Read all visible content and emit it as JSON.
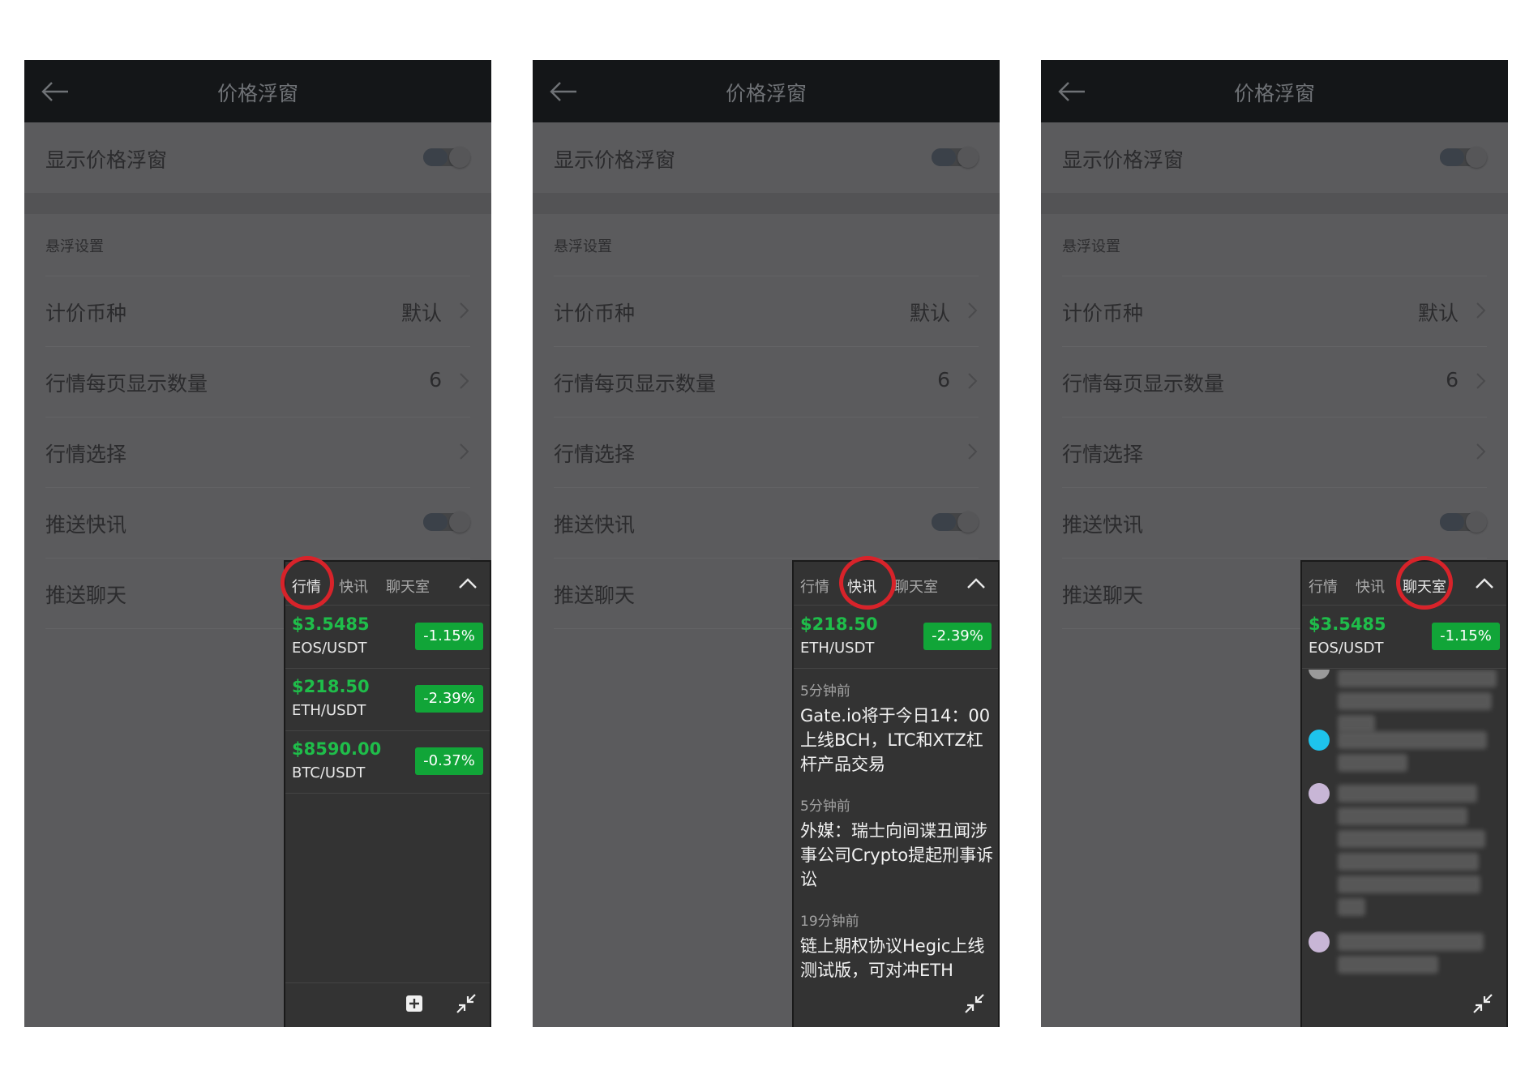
{
  "header": {
    "title": "价格浮窗"
  },
  "settings": {
    "show_float": "显示价格浮窗",
    "section": "悬浮设置",
    "currency_label": "计价币种",
    "currency_value": "默认",
    "per_page_label": "行情每页显示数量",
    "per_page_value": "6",
    "select_label": "行情选择",
    "push_news": "推送快讯",
    "push_chat": "推送聊天"
  },
  "tabs": {
    "market": "行情",
    "news": "快讯",
    "chat": "聊天室"
  },
  "quotes": [
    {
      "price": "$3.5485",
      "pair": "EOS/USDT",
      "change": "-1.15%"
    },
    {
      "price": "$218.50",
      "pair": "ETH/USDT",
      "change": "-2.39%"
    },
    {
      "price": "$8590.00",
      "pair": "BTC/USDT",
      "change": "-0.37%"
    }
  ],
  "news": [
    {
      "time": "5分钟前",
      "text": "Gate.io将于今日14：00上线BCH，LTC和XTZ杠杆产品交易"
    },
    {
      "time": "5分钟前",
      "text": "外媒：瑞士向间谍丑闻涉事公司Crypto提起刑事诉讼"
    },
    {
      "time": "19分钟前",
      "text": "链上期权协议Hegic上线测试版，可对冲ETH"
    }
  ],
  "colors": {
    "price_up": "#1fbd4a",
    "change_badge": "#11a538",
    "highlight": "#d8232a",
    "chat_dot_1": "#9a9a9a",
    "chat_dot_2": "#1ec3ec",
    "chat_dot_3": "#c8b6d6",
    "chat_dot_4": "#c8b6d6"
  },
  "icons": [
    "back-arrow-icon",
    "chevron-right-icon",
    "chevron-up-icon",
    "plus-square-icon",
    "shrink-arrows-icon"
  ]
}
